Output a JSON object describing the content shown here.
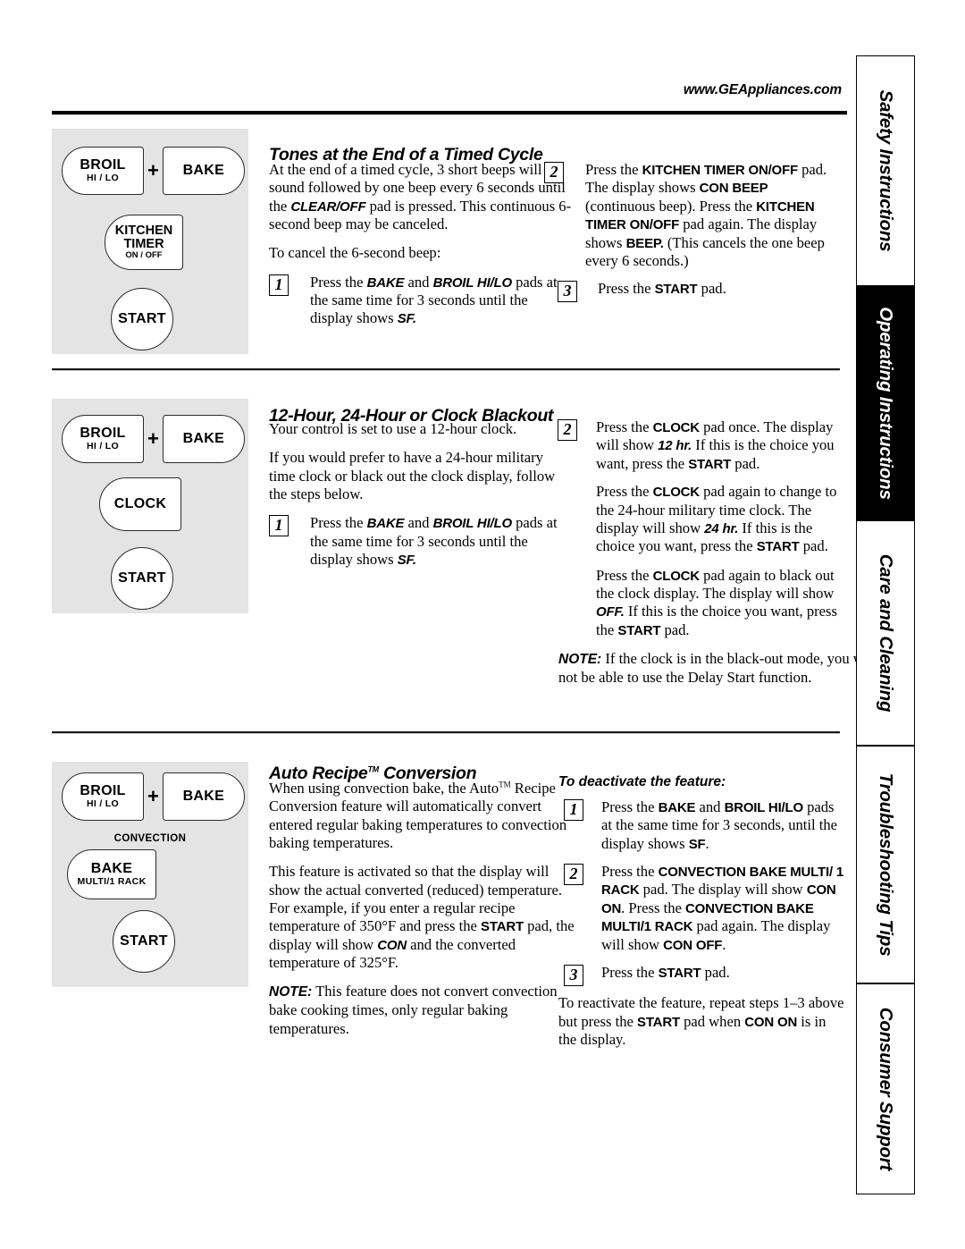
{
  "header": {
    "site_url": "www.GEAppliances.com"
  },
  "side_tabs": [
    {
      "label": "Safety Instructions",
      "active": false
    },
    {
      "label": "Operating Instructions",
      "active": true
    },
    {
      "label": "Care and Cleaning",
      "active": false
    },
    {
      "label": "Troubleshooting Tips",
      "active": false
    },
    {
      "label": "Consumer Support",
      "active": false
    }
  ],
  "sections": [
    {
      "id": "tones",
      "title": "Tones at the End of a Timed Cycle",
      "panel": {
        "plus": "+",
        "pads": [
          {
            "line1": "BROIL",
            "line2": "HI / LO"
          },
          {
            "line1": "BAKE",
            "line2": ""
          },
          {
            "line1": "KITCHEN",
            "line2": "TIMER",
            "line3": "ON / OFF"
          },
          {
            "line1": "START",
            "line2": ""
          }
        ]
      },
      "left": {
        "p1_a": "At the end of a timed cycle, 3 short beeps will sound followed by one beep every 6 seconds until the ",
        "p1_cmd": "CLEAR/OFF",
        "p1_b": " pad is pressed. This continuous 6-second beep may be canceled.",
        "p2": "To cancel the 6-second beep:",
        "step1_num": "1",
        "step1_a": "Press the ",
        "step1_cmd1": "BAKE",
        "step1_b": " and ",
        "step1_cmd2": "BROIL HI/LO",
        "step1_c": " pads at the same time for 3 seconds until the display shows ",
        "step1_cmd3": "SF.",
        "step1_d": ""
      },
      "right": {
        "step2_num": "2",
        "step2_a": "Press the ",
        "step2_cmd1": "KITCHEN TIMER ON/OFF",
        "step2_b": " pad. The display shows ",
        "step2_cmd2": "CON BEEP",
        "step2_c": " (continuous beep). Press the ",
        "step2_cmd3": "KITCHEN TIMER ON/OFF",
        "step2_d": " pad again. The display shows ",
        "step2_cmd4": "BEEP.",
        "step2_e": " (This cancels the one beep every 6 seconds.)",
        "step3_num": "3",
        "step3_a": "Press the ",
        "step3_cmd1": "START",
        "step3_b": " pad."
      }
    },
    {
      "id": "clock",
      "title": "12-Hour, 24-Hour or Clock Blackout",
      "panel": {
        "plus": "+",
        "pads": [
          {
            "line1": "BROIL",
            "line2": "HI / LO"
          },
          {
            "line1": "BAKE",
            "line2": ""
          },
          {
            "line1": "CLOCK",
            "line2": ""
          },
          {
            "line1": "START",
            "line2": ""
          }
        ]
      },
      "left": {
        "p1": "Your control is set to use a 12-hour clock.",
        "p2": "If you would prefer to have a 24-hour military time clock or black out the clock display, follow the steps below.",
        "step1_num": "1",
        "step1_a": "Press the ",
        "step1_cmd1": "BAKE",
        "step1_b": " and ",
        "step1_cmd2": "BROIL HI/LO",
        "step1_c": " pads at the same time for 3 seconds until the display shows ",
        "step1_cmd3": "SF."
      },
      "right": {
        "step2_num": "2",
        "step2_a": "Press the ",
        "step2_cmd1": "CLOCK",
        "step2_b": " pad once. The display will show ",
        "step2_cmd2": "12 hr.",
        "step2_c": " If this is the choice you want, press the ",
        "step2_cmd3": "START",
        "step2_d": " pad.",
        "p2_a": "Press the ",
        "p2_cmd1": "CLOCK",
        "p2_b": " pad again to change to the 24-hour military time clock. The display will show ",
        "p2_cmd2": "24 hr.",
        "p2_c": " If this is the choice you want, press the ",
        "p2_cmd3": "START",
        "p2_d": " pad.",
        "p3_a": "Press the ",
        "p3_cmd1": "CLOCK",
        "p3_b": " pad again to black out the clock display. The display will show ",
        "p3_cmd2": "OFF.",
        "p3_c": " If this is the choice you want, press the ",
        "p3_cmd3": "START",
        "p3_d": " pad.",
        "note_label": "NOTE:",
        "note_text": " If the clock is in the black-out mode, you will not be able to use the Delay Start function."
      }
    },
    {
      "id": "autorecipe",
      "title": "Auto Recipe",
      "title_tm": "TM",
      "title_tail": " Conversion",
      "panel": {
        "plus": "+",
        "convection_label": "CONVECTION",
        "pads": [
          {
            "line1": "BROIL",
            "line2": "HI / LO"
          },
          {
            "line1": "BAKE",
            "line2": ""
          },
          {
            "line1": "BAKE",
            "line2": "MULTI/1 RACK"
          },
          {
            "line1": "START",
            "line2": ""
          }
        ]
      },
      "left": {
        "p1_a": "When using convection bake, the Auto",
        "p1_tm": "TM",
        "p1_b": " Recipe Conversion feature will automatically convert entered regular baking temperatures to convection baking temperatures.",
        "p2_a": "This feature is activated so that the display will show the actual converted (reduced) temperature. For example, if you enter a regular recipe temperature of 350°F and press the ",
        "p2_cmd1": "START",
        "p2_b": " pad, the display will show ",
        "p2_cmd2": "CON",
        "p2_c": " and the converted temperature of 325°F.",
        "note_label": "NOTE:",
        "note_text": " This feature does not convert convection bake cooking times, only regular baking temperatures."
      },
      "right": {
        "head": "To deactivate the feature:",
        "step1_num": "1",
        "step1_a": "Press the ",
        "step1_cmd1": "BAKE",
        "step1_b": " and ",
        "step1_cmd2": "BROIL HI/LO",
        "step1_c": " pads at the same time for 3 seconds, until the display shows ",
        "step1_cmd3": "SF",
        "step1_d": ".",
        "step2_num": "2",
        "step2_a": "Press the ",
        "step2_cmd1": "CONVECTION BAKE MULTI/ 1 RACK",
        "step2_b": " pad. The display will show ",
        "step2_cmd2": "CON ON",
        "step2_c": ". Press the ",
        "step2_cmd3": "CONVECTION BAKE MULTI/1 RACK",
        "step2_d": " pad again. The display will show ",
        "step2_cmd4": "CON OFF",
        "step2_e": ".",
        "step3_num": "3",
        "step3_a": "Press the ",
        "step3_cmd1": "START",
        "step3_b": " pad.",
        "p_tail_a": "To reactivate the feature, repeat steps 1–3 above but press the ",
        "p_tail_cmd1": "START",
        "p_tail_b": " pad when ",
        "p_tail_cmd2": "CON ON",
        "p_tail_c": " is in the display."
      }
    }
  ]
}
